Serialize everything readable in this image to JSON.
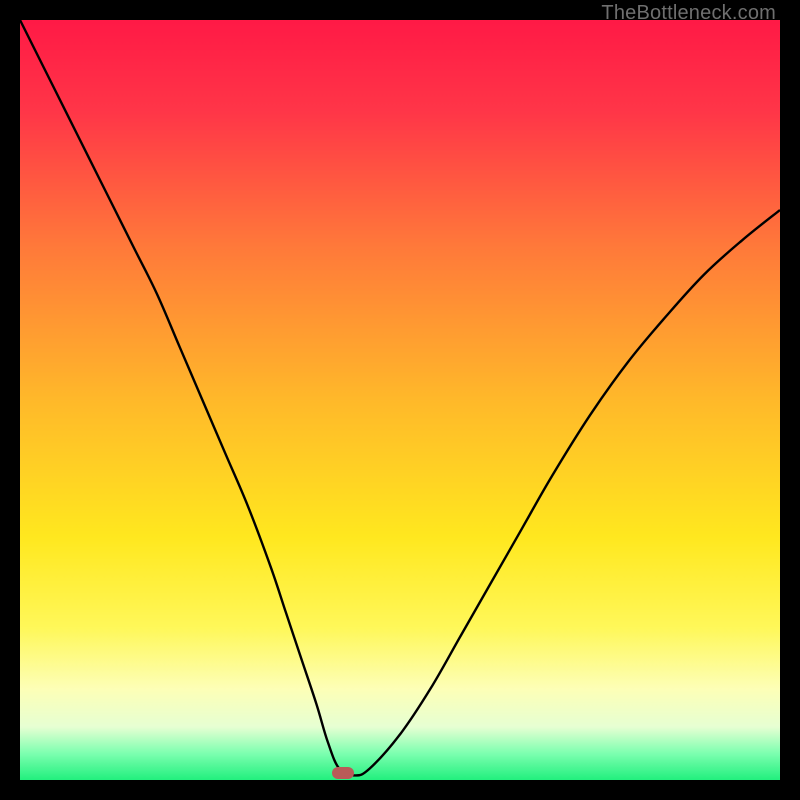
{
  "watermark": "TheBottleneck.com",
  "chart_data": {
    "type": "line",
    "title": "",
    "xlabel": "",
    "ylabel": "",
    "xlim": [
      0,
      100
    ],
    "ylim": [
      0,
      100
    ],
    "axes_visible": false,
    "grid": false,
    "background_gradient": [
      {
        "pct": 0.0,
        "color": "#ff1a46"
      },
      {
        "pct": 0.12,
        "color": "#ff3648"
      },
      {
        "pct": 0.3,
        "color": "#ff7a3a"
      },
      {
        "pct": 0.5,
        "color": "#ffb92a"
      },
      {
        "pct": 0.68,
        "color": "#ffe81f"
      },
      {
        "pct": 0.8,
        "color": "#fff85a"
      },
      {
        "pct": 0.88,
        "color": "#fdffb7"
      },
      {
        "pct": 0.93,
        "color": "#e7ffd3"
      },
      {
        "pct": 0.965,
        "color": "#7dffb0"
      },
      {
        "pct": 1.0,
        "color": "#22f07e"
      }
    ],
    "series": [
      {
        "name": "bottleneck-curve",
        "color": "#000000",
        "stroke_width": 2.4,
        "x": [
          0,
          3,
          6,
          9,
          12,
          15,
          18,
          21,
          24,
          27,
          30,
          33,
          35,
          37,
          39,
          40.5,
          42,
          44,
          46,
          50,
          54,
          58,
          62,
          66,
          70,
          75,
          80,
          85,
          90,
          95,
          100
        ],
        "y": [
          100,
          94,
          88,
          82,
          76,
          70,
          64,
          57,
          50,
          43,
          36,
          28,
          22,
          16,
          10,
          5,
          1.5,
          0.6,
          1.5,
          6,
          12,
          19,
          26,
          33,
          40,
          48,
          55,
          61,
          66.5,
          71,
          75
        ]
      }
    ],
    "marker": {
      "x": 42.5,
      "y": 0.9,
      "color": "#b95a58",
      "shape": "pill"
    }
  }
}
